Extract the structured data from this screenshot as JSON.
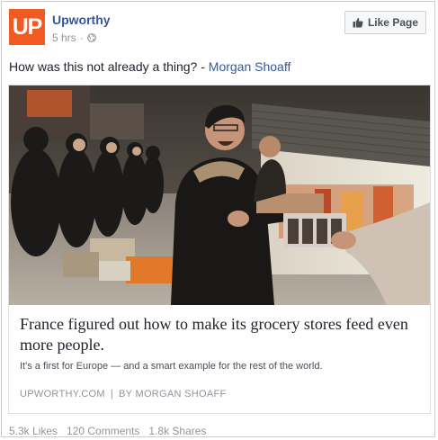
{
  "page": {
    "logo_text": "UP",
    "name": "Upworthy",
    "time": "5 hrs",
    "dot": "·",
    "like_label": "Like Page"
  },
  "post": {
    "text_prefix": "How was this not already a thing? - ",
    "text_author": "Morgan Shoaff"
  },
  "link": {
    "headline": "France figured out how to make its grocery stores feed even more people.",
    "description": "It's a first for Europe — and a smart example for the rest of the world.",
    "domain": "UPWORTHY.COM",
    "separator": "|",
    "byline": "BY MORGAN SHOAFF"
  },
  "stats": {
    "likes": "5.3k Likes",
    "comments": "120 Comments",
    "shares": "1.8k Shares"
  },
  "colors": {
    "brand": "#f15a22",
    "link": "#365899",
    "muted": "#90949c"
  }
}
